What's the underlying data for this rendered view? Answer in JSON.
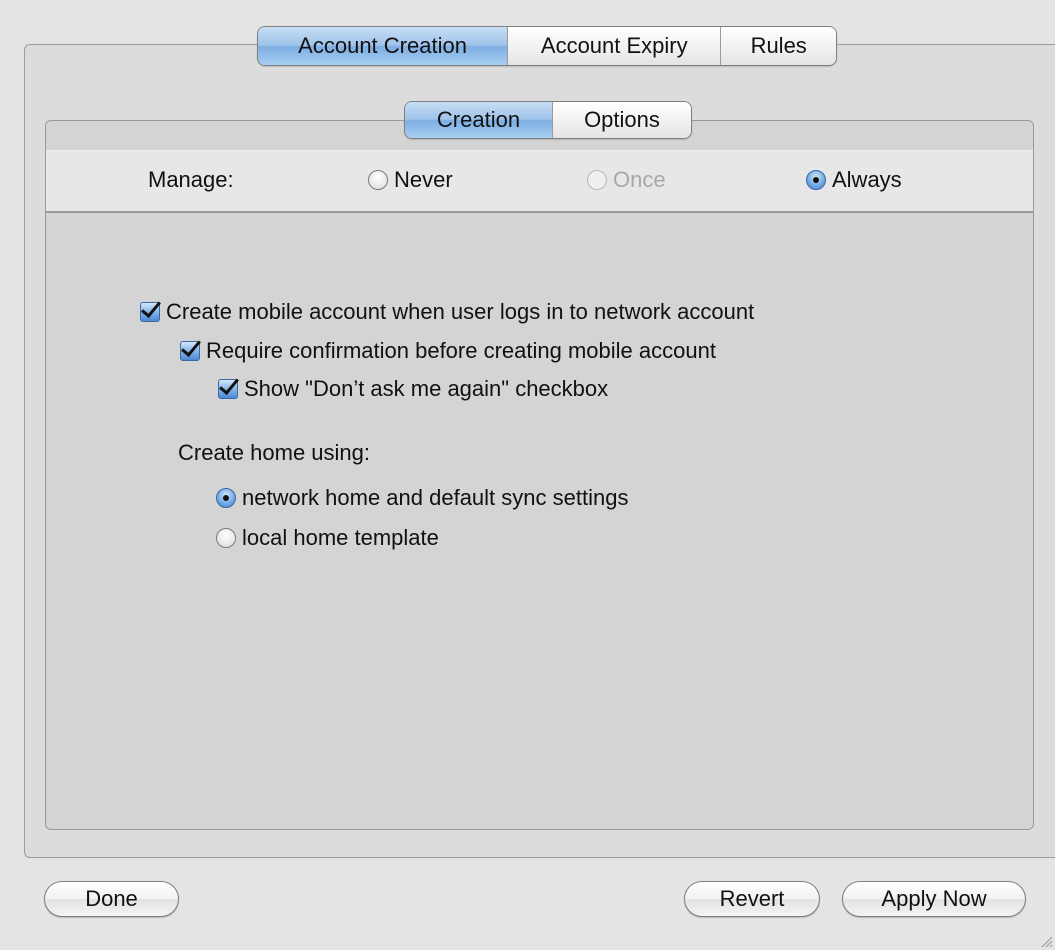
{
  "tabs": {
    "outer": [
      "Account Creation",
      "Account Expiry",
      "Rules"
    ],
    "outer_selected": "Account Creation",
    "inner": [
      "Creation",
      "Options"
    ],
    "inner_selected": "Creation"
  },
  "manage": {
    "label": "Manage:",
    "options": [
      {
        "label": "Never",
        "checked": false,
        "enabled": true
      },
      {
        "label": "Once",
        "checked": false,
        "enabled": false
      },
      {
        "label": "Always",
        "checked": true,
        "enabled": true
      }
    ]
  },
  "checkboxes": [
    {
      "label": "Create mobile account when user logs in to network account",
      "checked": true
    },
    {
      "label": "Require confirmation before creating mobile account",
      "checked": true
    },
    {
      "label": "Show \"Don’t ask me again\" checkbox",
      "checked": true
    }
  ],
  "home": {
    "label": "Create home using:",
    "options": [
      {
        "label": "network home and default sync settings",
        "checked": true
      },
      {
        "label": "local home template",
        "checked": false
      }
    ]
  },
  "buttons": {
    "done": "Done",
    "revert": "Revert",
    "apply": "Apply Now"
  },
  "colors": {
    "tab_selected": "#8fb9e9",
    "panel": "#d4d4d4",
    "control_accent": "#4d88d0"
  }
}
